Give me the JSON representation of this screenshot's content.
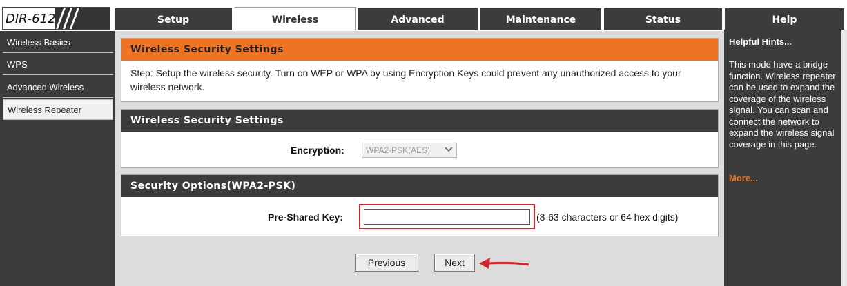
{
  "brand": {
    "model": "DIR-612"
  },
  "tabs": [
    {
      "label": "Setup"
    },
    {
      "label": "Wireless"
    },
    {
      "label": "Advanced"
    },
    {
      "label": "Maintenance"
    },
    {
      "label": "Status"
    },
    {
      "label": "Help"
    }
  ],
  "active_tab": "Wireless",
  "sidebar": {
    "items": [
      {
        "label": "Wireless Basics"
      },
      {
        "label": "WPS"
      },
      {
        "label": "Advanced Wireless"
      },
      {
        "label": "Wireless Repeater"
      }
    ],
    "active": "Wireless Repeater"
  },
  "intro": {
    "title": "Wireless Security Settings",
    "text": "Step: Setup the wireless security. Turn on WEP or WPA by using Encryption Keys could prevent any unauthorized access to your wireless network."
  },
  "security_settings": {
    "title": "Wireless Security Settings",
    "encryption_label": "Encryption:",
    "encryption_value": "WPA2-PSK(AES)"
  },
  "security_options": {
    "title": "Security Options(WPA2-PSK)",
    "key_label": "Pre-Shared Key:",
    "key_value": "",
    "key_hint": "(8-63 characters or 64 hex digits)"
  },
  "buttons": {
    "previous": "Previous",
    "next": "Next"
  },
  "help": {
    "title": "Helpful Hints...",
    "body": "This mode have a bridge function. Wireless repeater can be used to expand the coverage of the wireless signal. You can scan and connect the network to expand the wireless signal coverage in this page.",
    "more": "More..."
  },
  "colors": {
    "header_orange": "#ef7322",
    "dark_panel": "#3c3c3c",
    "highlight_red": "#d0262a",
    "more_link": "#e8752a"
  },
  "icons": {
    "dropdown": "chevron-down-icon",
    "annotation": "red-arrow-icon"
  }
}
